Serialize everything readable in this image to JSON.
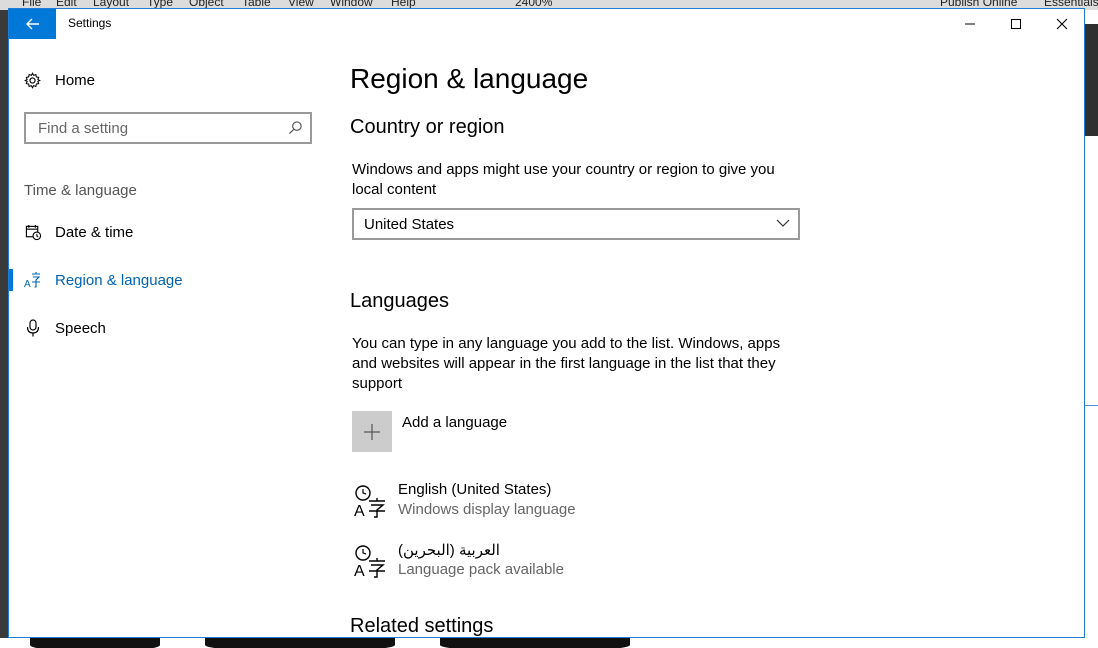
{
  "background_app": {
    "menu": [
      "File",
      "Edit",
      "Layout",
      "Type",
      "Object",
      "Table",
      "View",
      "Window",
      "Help"
    ],
    "zoom": "2400%",
    "publish": "Publish Online",
    "workspace": "Essentials"
  },
  "window": {
    "title": "Settings",
    "back_icon": "arrow-left-icon",
    "minimize_icon": "minimize-icon",
    "maximize_icon": "maximize-icon",
    "close_icon": "close-icon",
    "accent": "#0078d7"
  },
  "sidebar": {
    "home_label": "Home",
    "search_placeholder": "Find a setting",
    "section_label": "Time & language",
    "items": [
      {
        "label": "Date & time",
        "icon": "calendar-clock-icon",
        "active": false
      },
      {
        "label": "Region & language",
        "icon": "language-icon",
        "active": true
      },
      {
        "label": "Speech",
        "icon": "microphone-icon",
        "active": false
      }
    ]
  },
  "main": {
    "title": "Region & language",
    "country": {
      "heading": "Country or region",
      "description": "Windows and apps might use your country or region to give you local content",
      "selected": "United States"
    },
    "languages": {
      "heading": "Languages",
      "description": "You can type in any language you add to the list. Windows, apps and websites will appear in the first language in the list that they support",
      "add_label": "Add a language",
      "items": [
        {
          "name": "English (United States)",
          "status": "Windows display language"
        },
        {
          "name": "العربية (البحرين)",
          "status": "Language pack available"
        }
      ]
    },
    "related_heading": "Related settings"
  }
}
